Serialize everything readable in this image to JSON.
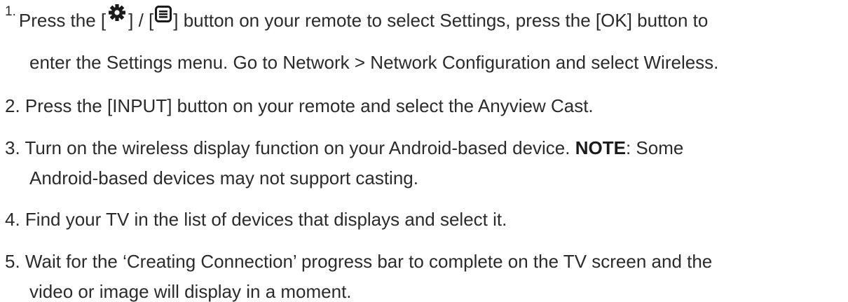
{
  "steps": [
    {
      "number": "1.",
      "text_a": "Press the [",
      "icon_1": "gear-icon",
      "text_b": "] / [",
      "icon_2": "menu-icon",
      "text_c": "] button on your remote to select Settings, press the [OK] button to",
      "line2": "enter the Settings menu. Go to Network > Network Configuration and select Wireless."
    },
    {
      "number": "2.",
      "line1": "Press the [INPUT] button on your remote and select the Anyview Cast."
    },
    {
      "number": "3.",
      "line1_a": "Turn on the wireless display function on your Android-based device. ",
      "note_label": "NOTE",
      "line1_b": ": Some",
      "line2": "Android-based devices may not support casting."
    },
    {
      "number": "4.",
      "line1": "Find your TV in the list of devices that displays and select it."
    },
    {
      "number": "5.",
      "line1": "Wait for the ‘Creating Connection’ progress bar to complete on the TV screen and the",
      "line2": "video or image will display in a moment."
    }
  ]
}
